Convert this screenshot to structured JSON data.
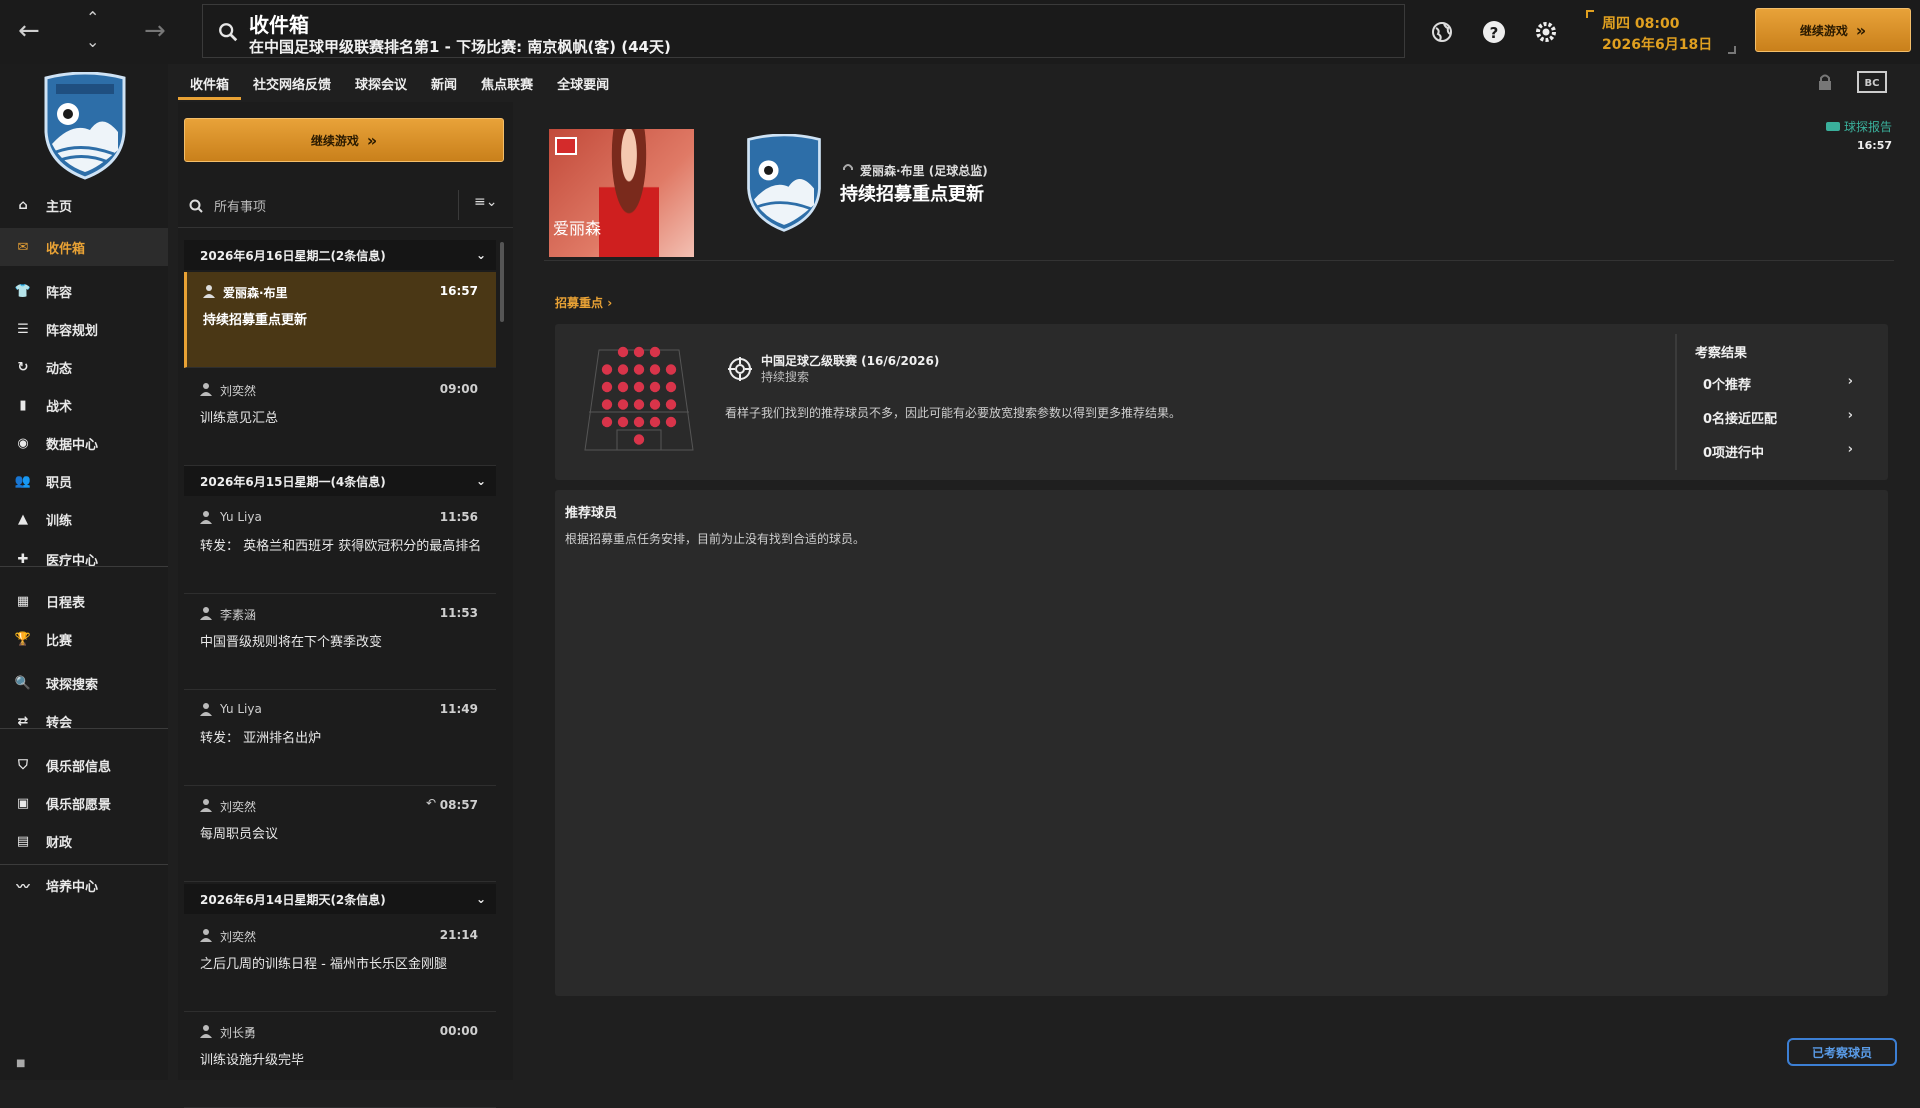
{
  "topbar": {
    "title": "收件箱",
    "subtitle": "在中国足球甲级联赛排名第1 - 下场比赛: 南京枫帆(客) (44天)",
    "date_line1": "周四 08:00",
    "date_line2": "2026年6月18日",
    "continue_label": "继续游戏"
  },
  "sidebar": {
    "items": [
      {
        "label": "主页",
        "icon": "home-icon"
      },
      {
        "label": "收件箱",
        "icon": "inbox-icon"
      },
      {
        "label": "阵容",
        "icon": "squad-icon"
      },
      {
        "label": "阵容规划",
        "icon": "squad-planner-icon"
      },
      {
        "label": "动态",
        "icon": "dynamics-icon"
      },
      {
        "label": "战术",
        "icon": "tactics-icon"
      },
      {
        "label": "数据中心",
        "icon": "data-hub-icon"
      },
      {
        "label": "职员",
        "icon": "staff-icon"
      },
      {
        "label": "训练",
        "icon": "training-icon"
      },
      {
        "label": "医疗中心",
        "icon": "medical-icon"
      },
      {
        "label": "日程表",
        "icon": "schedule-icon"
      },
      {
        "label": "比赛",
        "icon": "trophy-icon"
      },
      {
        "label": "球探搜索",
        "icon": "scouting-icon"
      },
      {
        "label": "转会",
        "icon": "transfer-icon"
      },
      {
        "label": "俱乐部信息",
        "icon": "club-info-icon"
      },
      {
        "label": "俱乐部愿景",
        "icon": "club-vision-icon"
      },
      {
        "label": "财政",
        "icon": "finance-icon"
      },
      {
        "label": "培养中心",
        "icon": "development-icon"
      }
    ]
  },
  "tabs": [
    "收件箱",
    "社交网络反馈",
    "球探会议",
    "新闻",
    "焦点联赛",
    "全球要闻"
  ],
  "left_panel": {
    "continue_label": "继续游戏",
    "search_placeholder": "所有事项",
    "groups": [
      {
        "header": "2026年6月16日星期二(2条信息)",
        "messages": [
          {
            "from": "爱丽森·布里",
            "time": "16:57",
            "subject": "持续招募重点更新"
          },
          {
            "from": "刘奕然",
            "time": "09:00",
            "subject": "训练意见汇总"
          }
        ]
      },
      {
        "header": "2026年6月15日星期一(4条信息)",
        "messages": [
          {
            "from": "Yu Liya",
            "time": "11:56",
            "subject": "转发： 英格兰和西班牙 获得欧冠积分的最高排名"
          },
          {
            "from": "李素涵",
            "time": "11:53",
            "subject": "中国晋级规则将在下个赛季改变"
          },
          {
            "from": "Yu Liya",
            "time": "11:49",
            "subject": "转发： 亚洲排名出炉"
          },
          {
            "from": "刘奕然",
            "time": "08:57",
            "subject": "每周职员会议"
          }
        ]
      },
      {
        "header": "2026年6月14日星期天(2条信息)",
        "messages": [
          {
            "from": "刘奕然",
            "time": "21:14",
            "subject": "之后几周的训练日程 - 福州市长乐区金刚腿"
          },
          {
            "from": "刘长勇",
            "time": "00:00",
            "subject": "训练设施升级完毕"
          }
        ]
      }
    ]
  },
  "message": {
    "photo_caption": "爱丽森",
    "sender": "爱丽森·布里 (足球总监)",
    "title": "持续招募重点更新",
    "scout_report_label": "球探报告",
    "scout_report_time": "16:57",
    "breadcrumb": "招募重点",
    "card": {
      "title": "中国足球乙级联赛 (16/6/2026)",
      "subtitle": "持续搜索",
      "description": "看样子我们找到的推荐球员不多，因此可能有必要放宽搜索参数以得到更多推荐结果。",
      "results_header": "考察结果",
      "results": [
        "0个推荐",
        "0名接近匹配",
        "0项进行中"
      ]
    },
    "recommended_header": "推荐球员",
    "recommended_text": "根据招募重点任务安排，目前为止没有找到合适的球员。"
  },
  "footer": {
    "badge_label": "已考察球员"
  },
  "colors": {
    "accent": "#e9a235",
    "teal": "#3aaf9b",
    "dot": "#d9344a"
  }
}
